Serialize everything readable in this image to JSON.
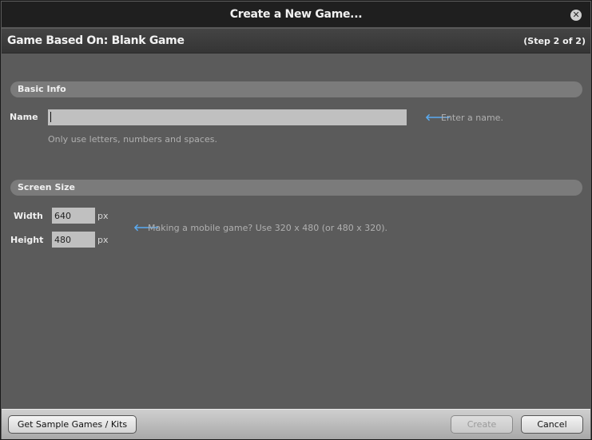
{
  "window": {
    "title": "Create a New Game...",
    "close_icon": "close-circle-icon"
  },
  "subheader": {
    "title": "Game Based On: Blank Game",
    "step": "(Step 2 of 2)"
  },
  "basic_info": {
    "section_title": "Basic Info",
    "name_label": "Name",
    "name_value": "",
    "name_hint_icon": "arrow-left-icon",
    "name_hint": "Enter a name.",
    "name_help": "Only use letters, numbers and spaces."
  },
  "screen_size": {
    "section_title": "Screen Size",
    "width_label": "Width",
    "width_value": "640",
    "width_unit": "px",
    "height_label": "Height",
    "height_value": "480",
    "height_unit": "px",
    "hint_icon": "arrow-left-icon",
    "hint": "Making a mobile game? Use 320 x 480 (or 480 x 320)."
  },
  "footer": {
    "sample_button": "Get Sample Games / Kits",
    "create_button": "Create",
    "create_enabled": false,
    "cancel_button": "Cancel"
  },
  "colors": {
    "accent_arrow": "#5aaaf0",
    "panel_bg": "#5b5b5b",
    "titlebar_bg": "#1f1f1f",
    "section_header_bg": "#7b7b7b"
  }
}
